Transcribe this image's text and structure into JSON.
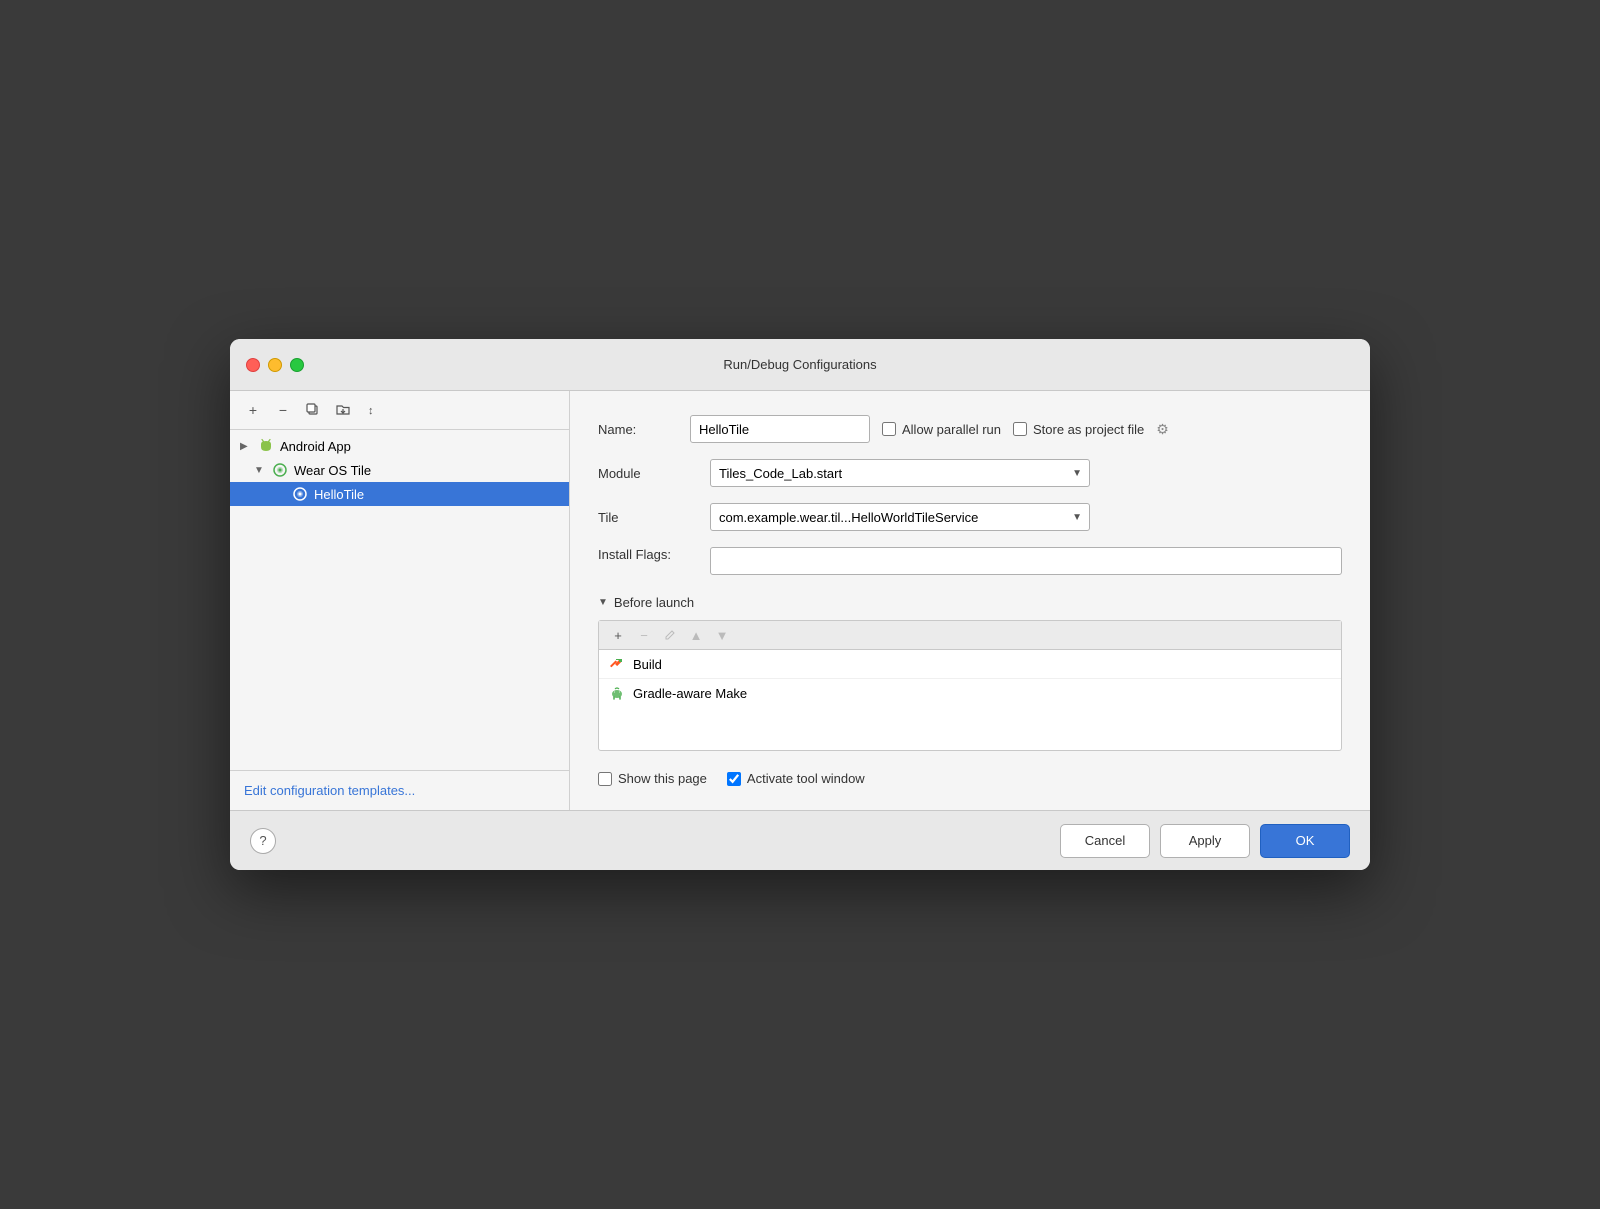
{
  "window": {
    "title": "Run/Debug Configurations"
  },
  "toolbar": {
    "add": "+",
    "remove": "−",
    "copy": "⧉",
    "folder": "📁",
    "sort": "↕"
  },
  "tree": {
    "android_app": {
      "label": "Android App",
      "expanded": false,
      "indent": 0
    },
    "wear_os_tile": {
      "label": "Wear OS Tile",
      "expanded": true,
      "indent": 1
    },
    "hello_tile": {
      "label": "HelloTile",
      "selected": true,
      "indent": 2
    }
  },
  "edit_templates": "Edit configuration templates...",
  "form": {
    "name_label": "Name:",
    "name_value": "HelloTile",
    "allow_parallel_label": "Allow parallel run",
    "allow_parallel_checked": false,
    "store_as_project_label": "Store as project file",
    "store_as_project_checked": false,
    "module_label": "Module",
    "module_value": "Tiles_Code_Lab.start",
    "tile_label": "Tile",
    "tile_value": "com.example.wear.til...HelloWorldTileService",
    "install_flags_label": "Install Flags:",
    "install_flags_value": "",
    "before_launch_title": "Before launch",
    "bl_toolbar": {
      "add": "+",
      "remove": "−",
      "edit": "✎",
      "up": "▲",
      "down": "▼"
    },
    "before_launch_items": [
      {
        "icon": "build",
        "label": "Build"
      },
      {
        "icon": "gradle",
        "label": "Gradle-aware Make"
      }
    ],
    "show_this_page_label": "Show this page",
    "show_this_page_checked": false,
    "activate_tool_window_label": "Activate tool window",
    "activate_tool_window_checked": true
  },
  "buttons": {
    "help": "?",
    "cancel": "Cancel",
    "apply": "Apply",
    "ok": "OK"
  },
  "colors": {
    "selected_bg": "#3875d7",
    "ok_btn_bg": "#3875d7",
    "link": "#3875d7"
  }
}
